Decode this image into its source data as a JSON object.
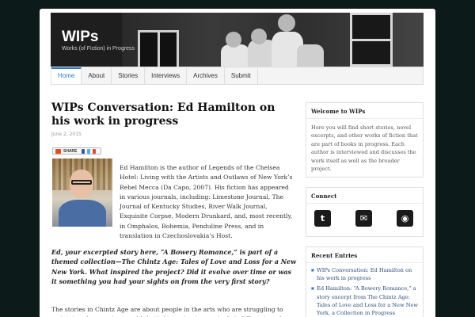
{
  "site": {
    "title": "WIPs",
    "tagline": "Works (of Fiction) in Progress"
  },
  "nav": {
    "items": [
      "Home",
      "About",
      "Stories",
      "Interviews",
      "Archives",
      "Submit"
    ],
    "active": "Home"
  },
  "post": {
    "title": "WIPs Conversation: Ed Hamilton on his work in progress",
    "date": "June 2, 2015",
    "share_label": "SHARE",
    "intro": "Ed Hamilton is the author of Legends of the Chelsea Hotel: Living with the Artists and Outlaws of New York’s Rebel Mecca (Da Capo, 2007). His fiction has appeared in various journals, including: Limestone Journal, The Journal of Kentucky Studies, River Walk Journal, Exquisite Corpse, Modern Drunkard, and, most recently, in Omphalos, Bohemia, Penduline Press, and in translation in Czechoslovakia’s Host.",
    "question": "Ed, your excerpted story here, “A Bowery Romance,” is part of a themed collection—The Chintz Age: Tales of Love and Loss for a New New York. What inspired the project? Did it evolve over time or was it something you had your sights on from the very first story?",
    "answer": "The stories in Chintz Age are about people in the arts who are struggling to maintain relevance in a world that’s becoming increasingly indifferent, and"
  },
  "sidebar": {
    "welcome": {
      "title": "Welcome to WIPs",
      "text": "Here you will find short stories, novel excerpts, and other works of fiction that are part of books in progress. Each author is interviewed and discusses the work itself as well as the broader project."
    },
    "connect": {
      "title": "Connect",
      "icons": [
        "twitter-icon",
        "email-icon",
        "rss-icon"
      ]
    },
    "recent": {
      "title": "Recent Entries",
      "entries": [
        "WIPs Conversation: Ed Hamilton on his work in progress",
        "Ed Hamilton: “A Bowery Romance,” a story excerpt from The Chintz Age: Tales of Love and Loss for a New New York, a Collection in Progress"
      ]
    }
  },
  "colors": {
    "accent": "#2a7ac8",
    "background": "#0d1a1a"
  }
}
